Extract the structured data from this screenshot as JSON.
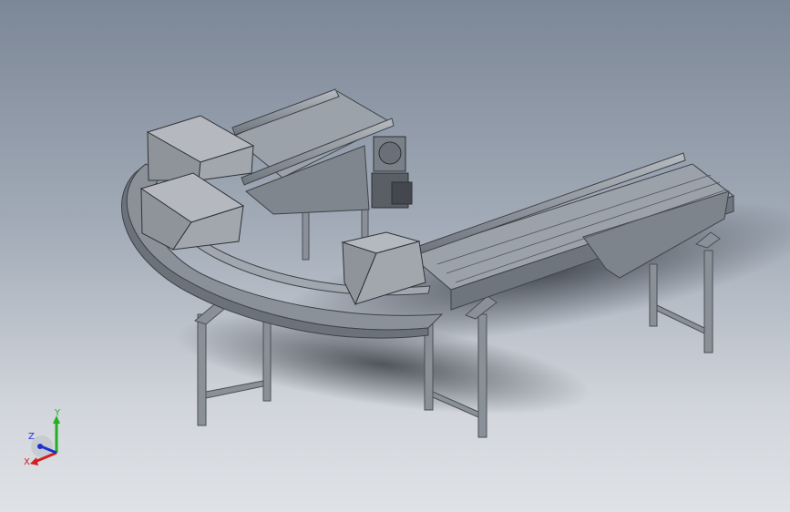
{
  "triad": {
    "x_label": "X",
    "y_label": "Y",
    "z_label": "Z",
    "x_color": "#d02020",
    "y_color": "#20b020",
    "z_color": "#2030d0"
  },
  "model": {
    "frame_color": "#8d939a",
    "box_color": "#9ea3aa",
    "motor_color": "#5a5f66"
  }
}
